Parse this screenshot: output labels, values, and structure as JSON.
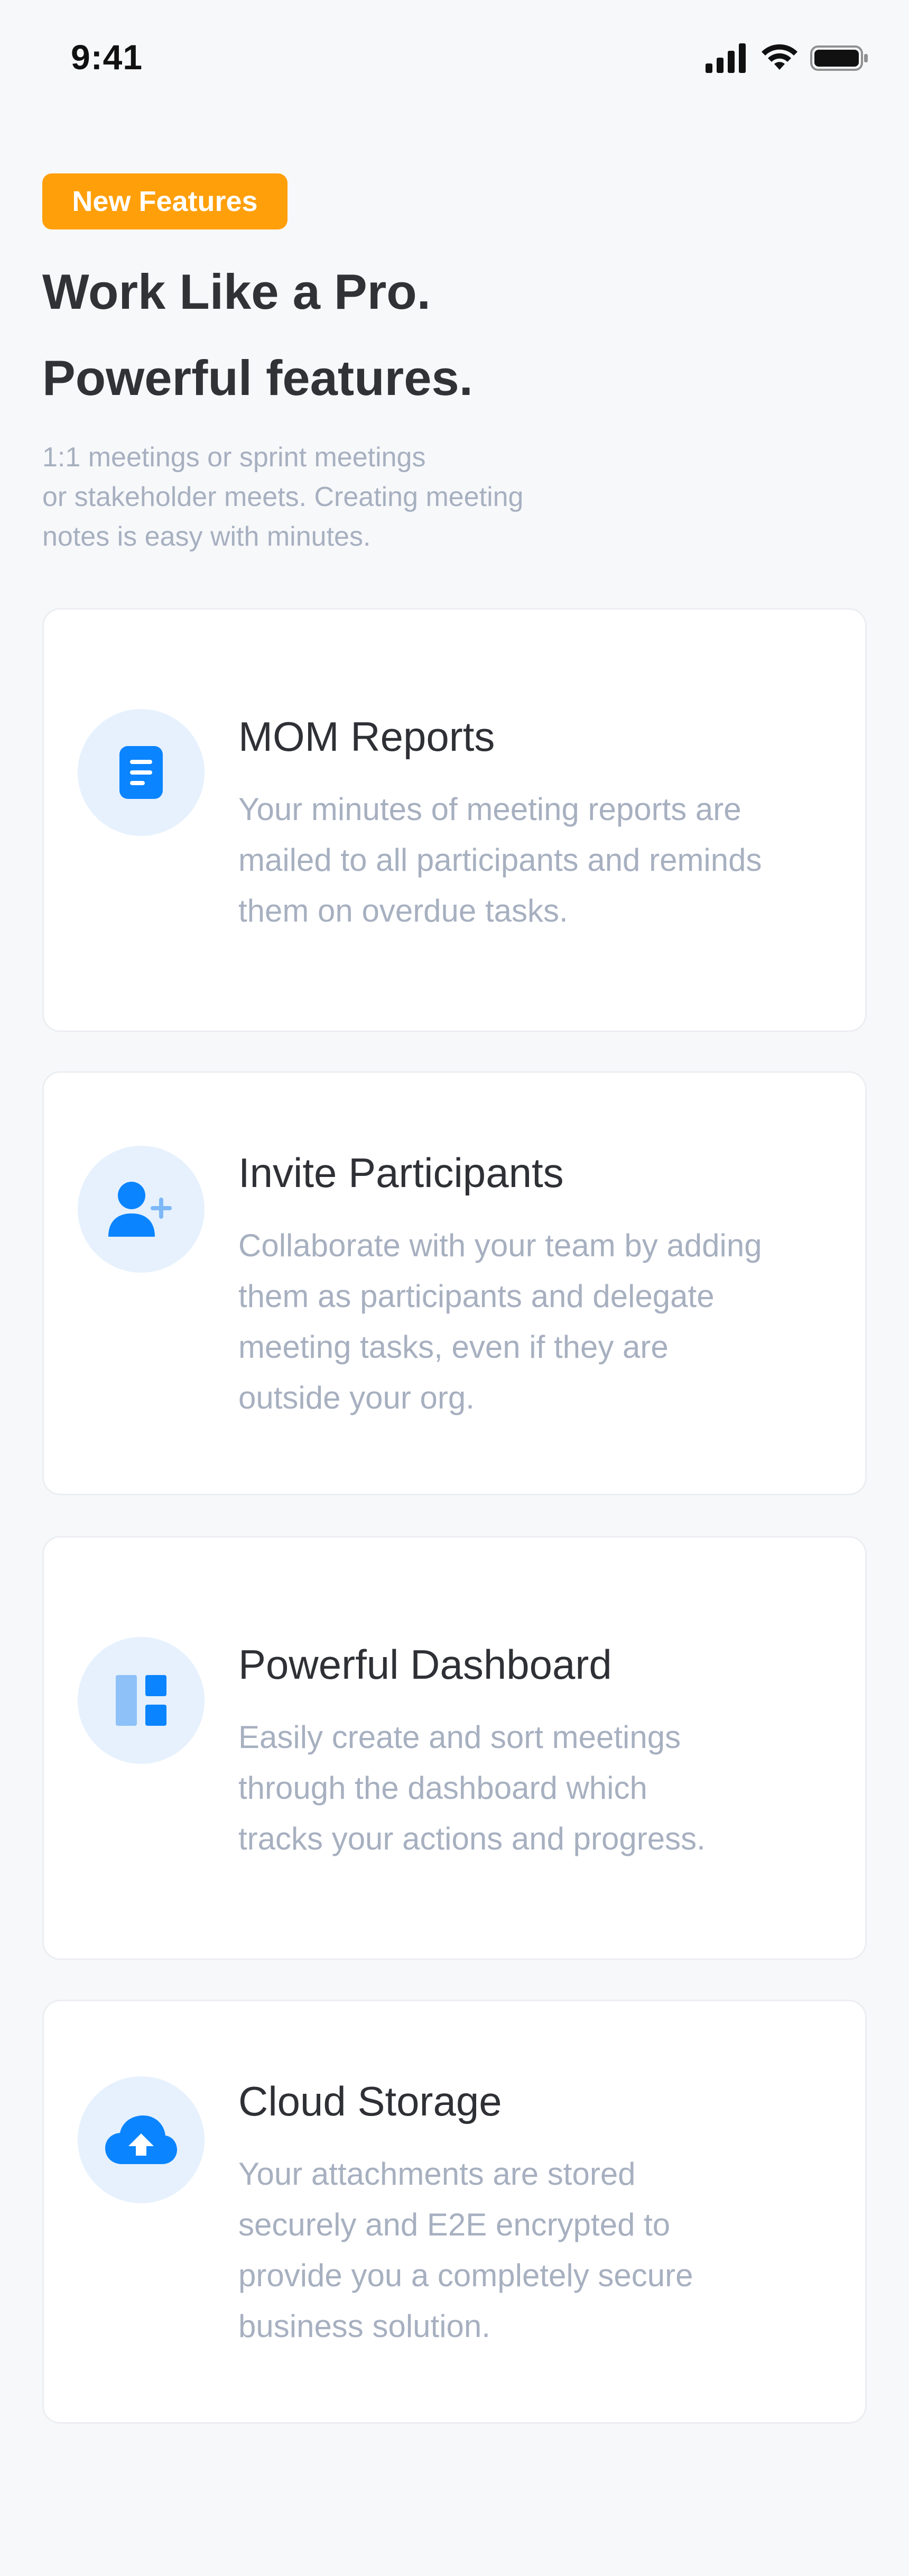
{
  "status_bar": {
    "time": "9:41",
    "icons": [
      "signal-icon",
      "wifi-icon",
      "battery-icon"
    ]
  },
  "badge": "New Features",
  "headline": [
    "Work Like a Pro.",
    "Powerful features."
  ],
  "subtitle_lines": [
    "1:1 meetings or sprint meetings",
    "or stakeholder meets. Creating meeting",
    "notes is easy with minutes."
  ],
  "features": [
    {
      "title": "MOM Reports",
      "icon": "document-icon",
      "description_lines": [
        "Your minutes of meeting reports are",
        "mailed to all participants and reminds",
        "them on overdue tasks."
      ]
    },
    {
      "title": "Invite Participants",
      "icon": "add-user-icon",
      "description_lines": [
        "Collaborate with your team by adding",
        "them as participants and delegate",
        "meeting tasks, even if they are",
        "outside your org."
      ]
    },
    {
      "title": "Powerful Dashboard",
      "icon": "dashboard-icon",
      "description_lines": [
        "Easily create and sort meetings",
        "through the dashboard which",
        "tracks your actions and progress."
      ]
    },
    {
      "title": "Cloud Storage",
      "icon": "cloud-upload-icon",
      "description_lines": [
        "Your attachments are stored",
        "securely and E2E encrypted to",
        "provide you a completely secure",
        "business solution."
      ]
    }
  ],
  "colors": {
    "background": "#F7F8FA",
    "badge": "#FF9F0A",
    "accent": "#0A84FF",
    "icon_bg": "#E6F1FD",
    "muted_text": "#A7B0C0",
    "heading_text": "#303236"
  }
}
